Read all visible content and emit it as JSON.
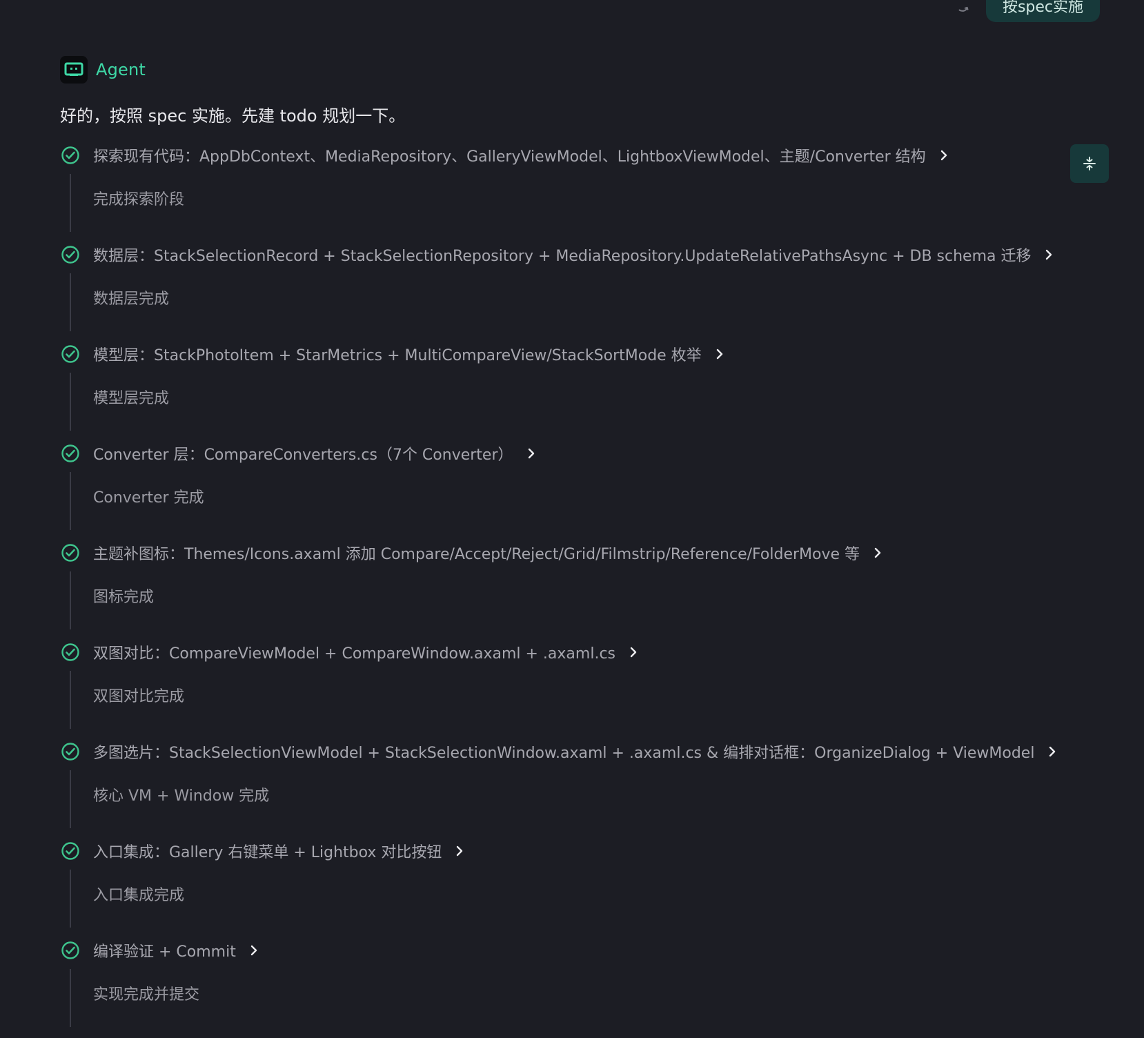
{
  "header": {
    "primary_action": "按spec实施"
  },
  "agent": {
    "name": "Agent",
    "message": "好的，按照 spec 实施。先建 todo 规划一下。"
  },
  "todos": [
    {
      "title": "探索现有代码：AppDbContext、MediaRepository、GalleryViewModel、LightboxViewModel、主题/Converter 结构",
      "note": "完成探索阶段"
    },
    {
      "title": "数据层：StackSelectionRecord + StackSelectionRepository + MediaRepository.UpdateRelativePathsAsync + DB schema 迁移",
      "note": "数据层完成"
    },
    {
      "title": "模型层：StackPhotoItem + StarMetrics + MultiCompareView/StackSortMode 枚举",
      "note": "模型层完成"
    },
    {
      "title": "Converter 层：CompareConverters.cs（7个 Converter）",
      "note": "Converter 完成"
    },
    {
      "title": "主题补图标：Themes/Icons.axaml 添加 Compare/Accept/Reject/Grid/Filmstrip/Reference/FolderMove 等",
      "note": "图标完成"
    },
    {
      "title": "双图对比：CompareViewModel + CompareWindow.axaml + .axaml.cs",
      "note": "双图对比完成"
    },
    {
      "title": "多图选片：StackSelectionViewModel + StackSelectionWindow.axaml + .axaml.cs & 编排对话框：OrganizeDialog + ViewModel",
      "note": "核心 VM + Window 完成"
    },
    {
      "title": "入口集成：Gallery 右键菜单 + Lightbox 对比按钮",
      "note": "入口集成完成"
    },
    {
      "title": "编译验证 + Commit",
      "note": "实现完成并提交"
    }
  ],
  "icons": {
    "undo": "undo-icon",
    "agent_avatar": "agent-avatar-icon",
    "collapse": "collapse-icon",
    "check": "check-circle-icon",
    "chevron": "chevron-right-icon"
  },
  "colors": {
    "background": "#1c1d24",
    "accent": "#3ed8a6",
    "button_bg": "#17393a",
    "todo_text": "#a7a7af",
    "note_text": "#9b9ba3"
  }
}
